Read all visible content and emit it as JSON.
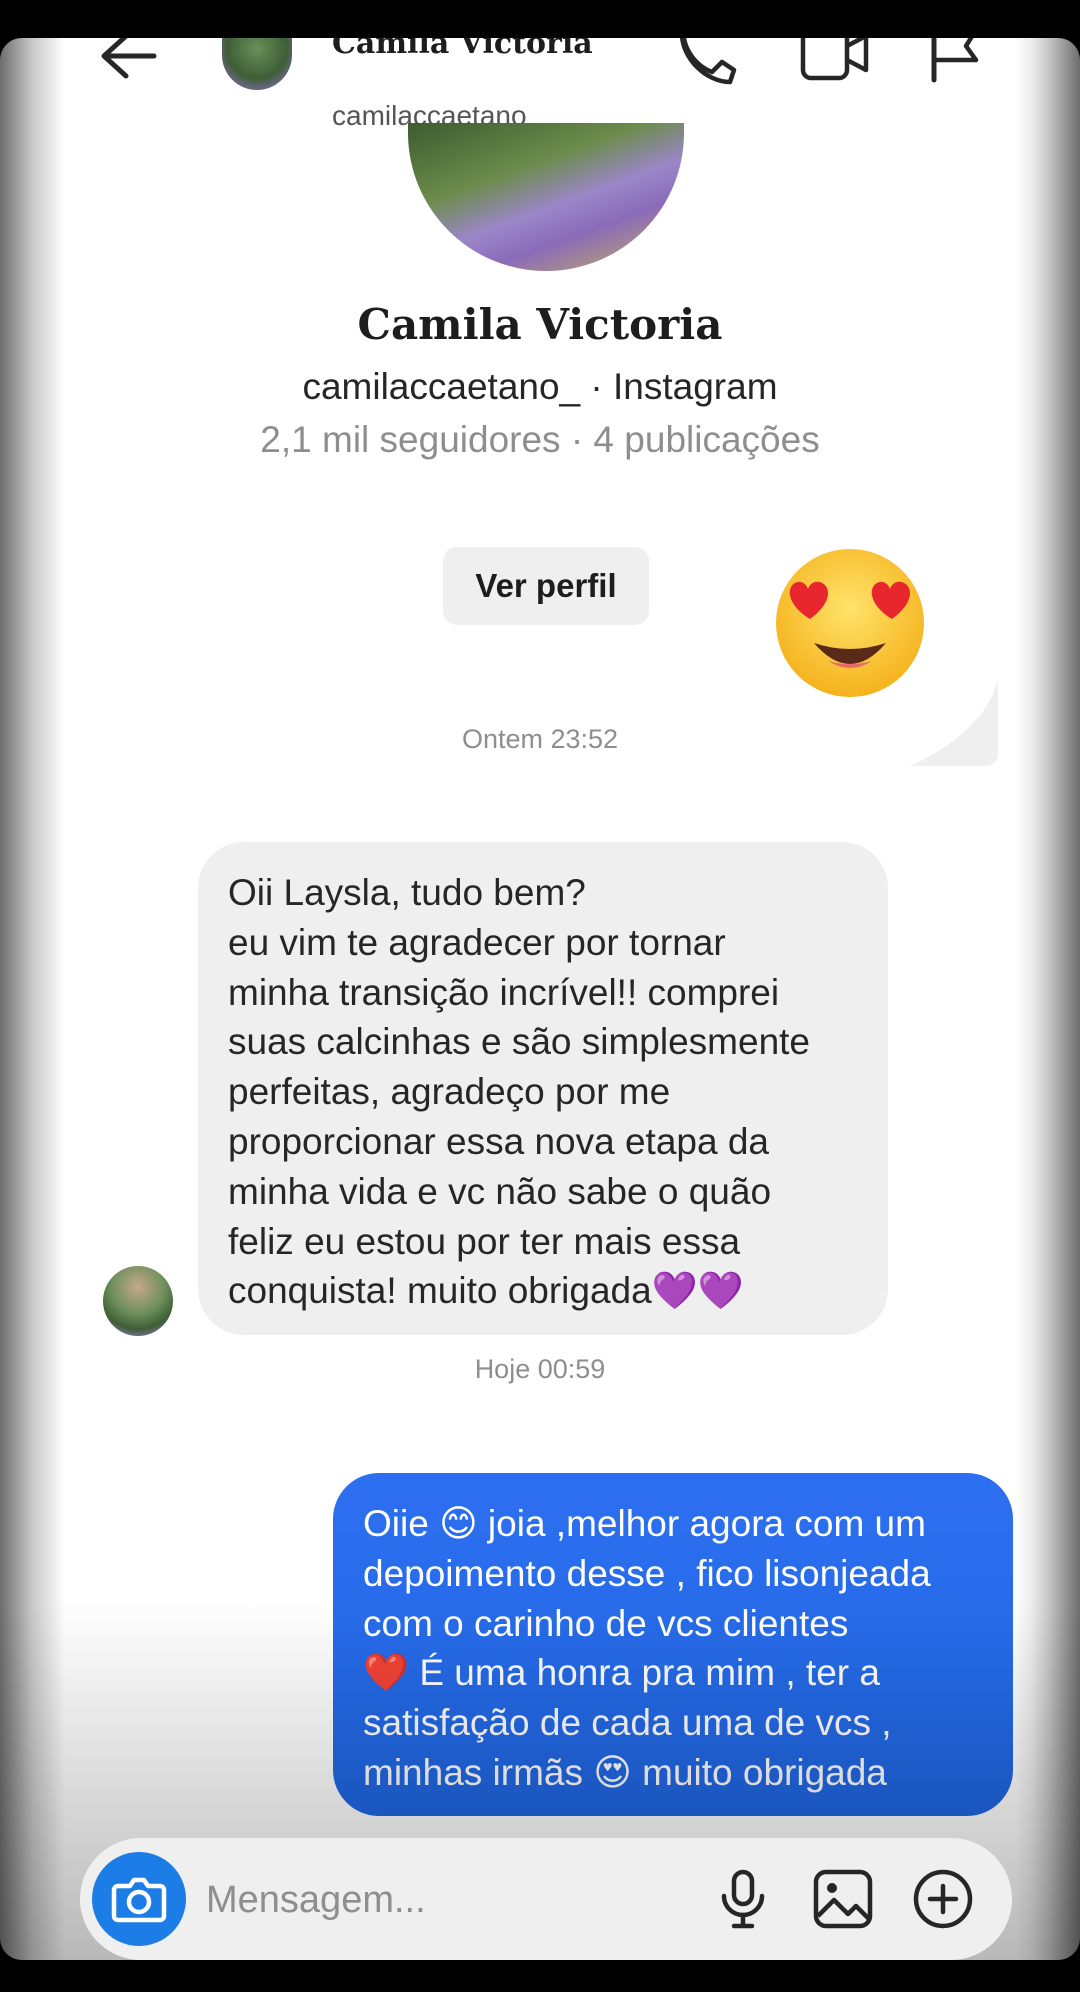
{
  "header": {
    "name": "Camila Victoria",
    "username": "camilaccaetano_"
  },
  "profile": {
    "name": "Camila Victoria",
    "subtitle": "camilaccaetano_ · Instagram",
    "stats": "2,1 mil seguidores · 4 publicações",
    "view_profile_label": "Ver perfil"
  },
  "messages": [
    {
      "type": "emoji",
      "from": "me",
      "text": "😍"
    },
    {
      "type": "timestamp",
      "text": "Ontem 23:52"
    },
    {
      "type": "text",
      "from": "them",
      "text": "Oii Laysla, tudo bem?\neu vim te agradecer por tornar\nminha transição incrível!! comprei\nsuas calcinhas e são simplesmente\nperfeitas, agradeço por me\nproporcionar essa nova etapa da\nminha vida e vc não sabe o quão\nfeliz eu estou por ter mais essa\nconquista! muito obrigada💜💜"
    },
    {
      "type": "timestamp",
      "text": "Hoje 00:59"
    },
    {
      "type": "text",
      "from": "me",
      "text": "Oiie 😊 joia ,melhor agora com um\ndepoimento desse , fico lisonjeada\ncom o carinho de vcs clientes\n❤️ É uma honra pra mim , ter a\nsatisfação de cada uma de vcs ,\nminhas irmãs 😍 muito obrigada"
    }
  ],
  "composer": {
    "placeholder": "Mensagem..."
  },
  "icons": {
    "back": "arrow-left-icon",
    "call": "phone-icon",
    "video": "video-camera-icon",
    "report": "flag-icon",
    "camera": "camera-icon",
    "mic": "microphone-icon",
    "gallery": "image-icon",
    "add": "plus-circle-icon"
  },
  "colors": {
    "outgoing_bubble": "#2468ea",
    "incoming_bubble": "#efefef",
    "camera_button": "#1c7de6"
  }
}
